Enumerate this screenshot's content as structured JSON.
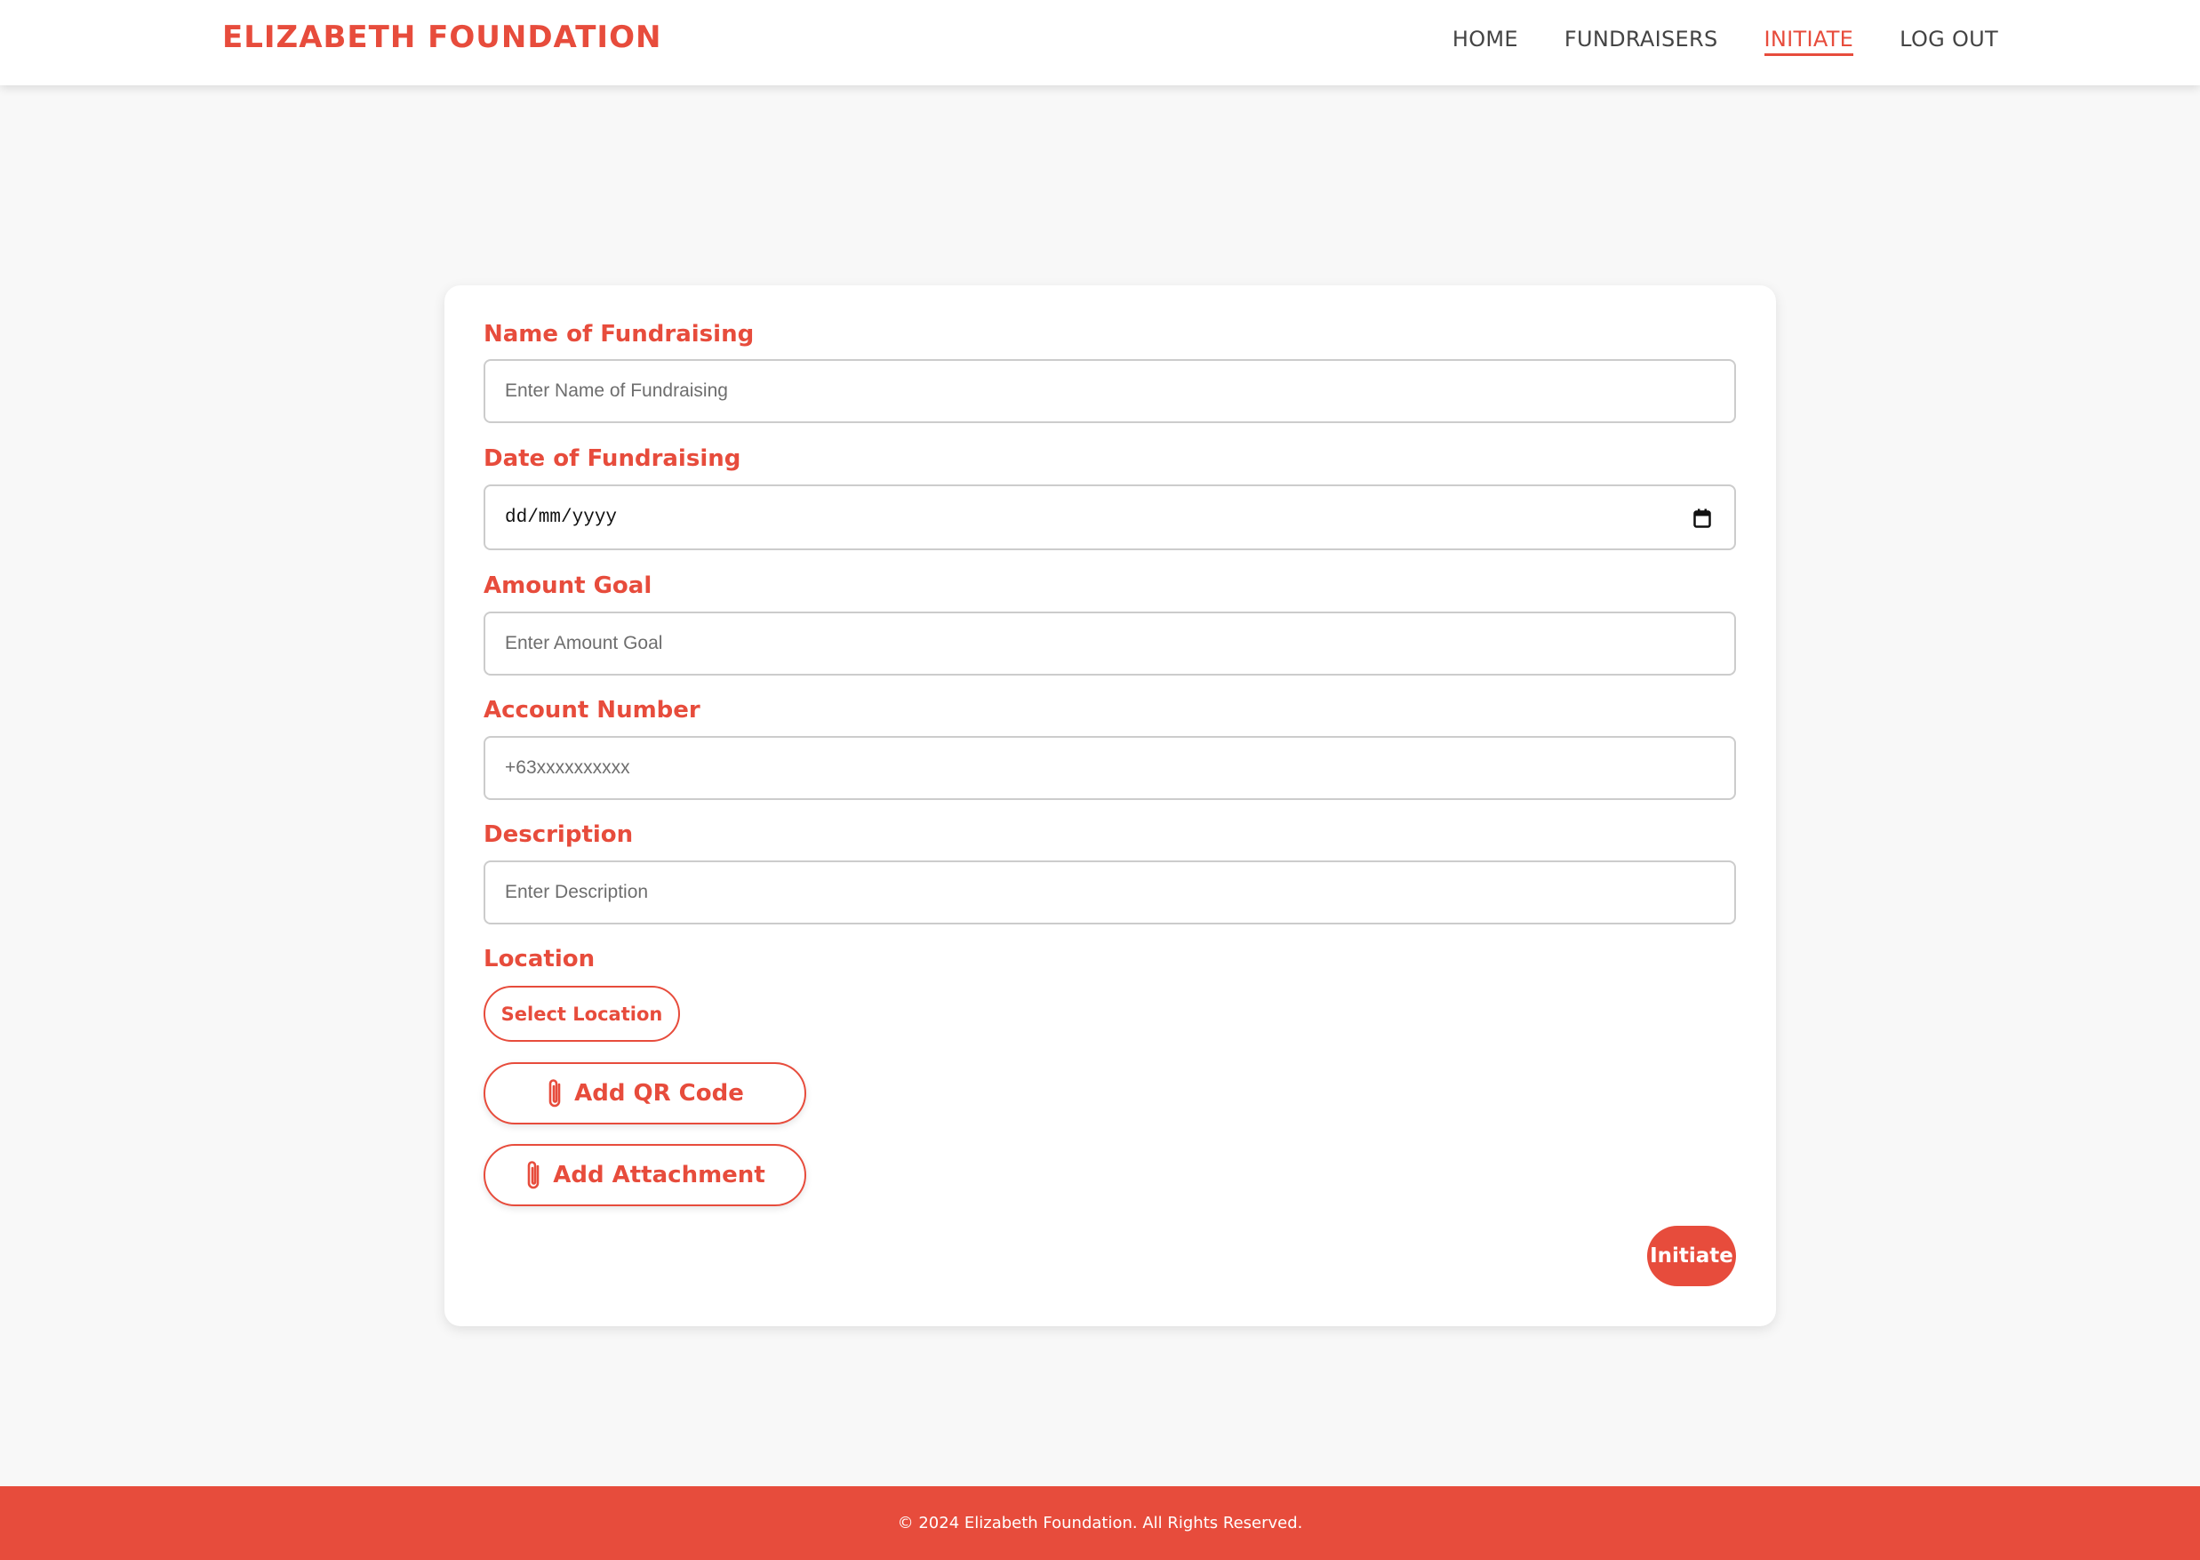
{
  "brand": {
    "name": "ELIZABETH FOUNDATION",
    "color": "#e74c3c"
  },
  "nav": {
    "items": [
      {
        "label": "HOME",
        "active": false
      },
      {
        "label": "FUNDRAISERS",
        "active": false
      },
      {
        "label": "INITIATE",
        "active": true
      },
      {
        "label": "LOG OUT",
        "active": false
      }
    ]
  },
  "form": {
    "name": {
      "label": "Name of Fundraising",
      "placeholder": "Enter Name of Fundraising",
      "value": ""
    },
    "date": {
      "label": "Date of Fundraising",
      "display": "dd/mm/yyyy",
      "icon": "calendar-icon"
    },
    "amount": {
      "label": "Amount Goal",
      "placeholder": "Enter Amount Goal",
      "value": ""
    },
    "account": {
      "label": "Account Number",
      "placeholder": "+63xxxxxxxxxx",
      "value": ""
    },
    "description": {
      "label": "Description",
      "placeholder": "Enter Description",
      "value": ""
    },
    "location": {
      "label": "Location",
      "button": "Select Location"
    },
    "qr_button": {
      "label": "Add QR Code",
      "icon": "paperclip-icon"
    },
    "attachment_button": {
      "label": "Add Attachment",
      "icon": "paperclip-icon"
    },
    "submit": {
      "label": "Initiate"
    }
  },
  "footer": {
    "text": "© 2024 Elizabeth Foundation. All Rights Reserved."
  },
  "colors": {
    "accent": "#e74c3c",
    "background": "#f8f8f8",
    "card": "#ffffff"
  }
}
